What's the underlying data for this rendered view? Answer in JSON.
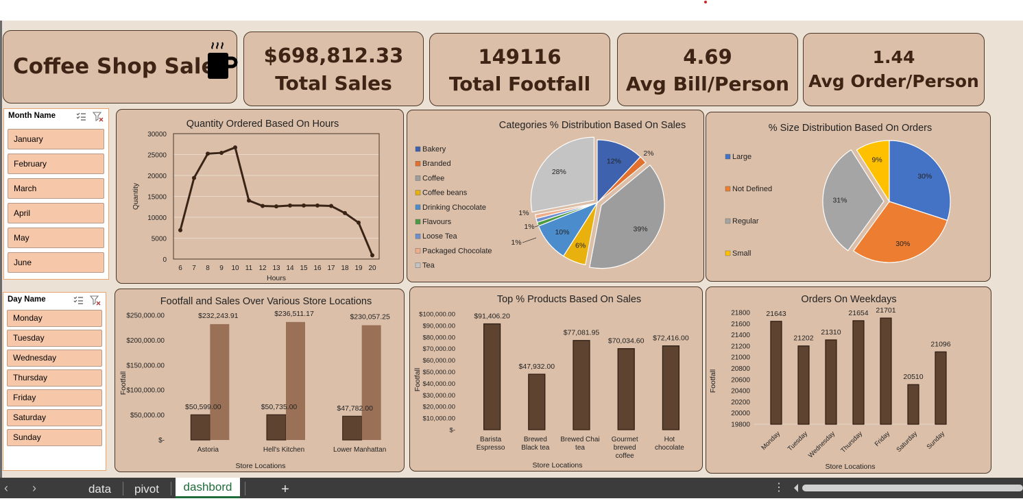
{
  "dashboard": {
    "title": "Coffee Shop Sales"
  },
  "kpis": [
    {
      "value": "$698,812.33",
      "label": "Total Sales"
    },
    {
      "value": "149116",
      "label": "Total Footfall"
    },
    {
      "value": "4.69",
      "label": "Avg Bill/Person"
    },
    {
      "value": "1.44",
      "label": "Avg Order/Person"
    }
  ],
  "slicers": {
    "month": {
      "title": "Month Name",
      "items": [
        "January",
        "February",
        "March",
        "April",
        "May",
        "June"
      ]
    },
    "day": {
      "title": "Day Name",
      "items": [
        "Monday",
        "Tuesday",
        "Wednesday",
        "Thursday",
        "Friday",
        "Saturday",
        "Sunday"
      ]
    }
  },
  "tabs": {
    "data": "data",
    "pivot": "pivot",
    "dashboard": "dashbord",
    "add": "+"
  },
  "colors": {
    "card": "#dbbfa9",
    "border": "#4a3526",
    "dark_bar": "#5e4330",
    "light_bar": "#9a7157",
    "line": "#3a2416"
  },
  "chart_data": [
    {
      "type": "line",
      "title": "Quantity Ordered Based On Hours",
      "xlabel": "Hours",
      "ylabel": "Quantity",
      "categories": [
        "6",
        "7",
        "8",
        "9",
        "10",
        "11",
        "12",
        "13",
        "14",
        "15",
        "16",
        "17",
        "18",
        "19",
        "20"
      ],
      "values": [
        6900,
        19400,
        25200,
        25400,
        26700,
        14000,
        12700,
        12600,
        12800,
        12800,
        12800,
        12700,
        11000,
        8700,
        900
      ],
      "ylim": [
        0,
        30000
      ],
      "yticks": [
        "0",
        "5000",
        "10000",
        "15000",
        "20000",
        "25000",
        "30000"
      ],
      "grid": true
    },
    {
      "type": "pie",
      "title": "Categories % Distribution Based On Sales",
      "legend": [
        "Bakery",
        "Branded",
        "Coffee",
        "Coffee beans",
        "Drinking Chocolate",
        "Flavours",
        "Loose Tea",
        "Packaged Chocolate",
        "Tea"
      ],
      "values": [
        12,
        2,
        39,
        6,
        10,
        1,
        1,
        1,
        28
      ],
      "labels": [
        "12%",
        "2%",
        "39%",
        "6%",
        "10%",
        "1%",
        "1%",
        "1%",
        "28%"
      ],
      "colors": [
        "#3e62ad",
        "#e2702e",
        "#9d9d9d",
        "#e8b10d",
        "#4b8dcc",
        "#4c9a43",
        "#6e8fcf",
        "#f0ad8a",
        "#c4c4c4"
      ],
      "legend_position": "left"
    },
    {
      "type": "pie",
      "title": "% Size Distribution Based On Orders",
      "legend": [
        "Large",
        "Not Defined",
        "Regular",
        "Small"
      ],
      "values": [
        30,
        30,
        31,
        9
      ],
      "labels": [
        "30%",
        "30%",
        "31%",
        "9%"
      ],
      "colors": [
        "#4472c4",
        "#ed7d31",
        "#a5a5a5",
        "#ffc000"
      ],
      "legend_position": "left"
    },
    {
      "type": "bar",
      "title": "Footfall  and Sales Over Various Store Locations",
      "xlabel": "Store Locations",
      "ylabel": "Footfall",
      "categories": [
        "Astoria",
        "Hell's Kitchen",
        "Lower Manhattan"
      ],
      "series": [
        {
          "values": [
            50599.0,
            50735.0,
            47782.0
          ],
          "labels": [
            "$50,599.00",
            "$50,735.00",
            "$47,782.00"
          ]
        },
        {
          "values": [
            232243.91,
            236511.17,
            230057.25
          ],
          "labels": [
            "$232,243.91",
            "$236,511.17",
            "$230,057.25"
          ]
        }
      ],
      "ylim": [
        0,
        250000
      ],
      "yticks": [
        "$-",
        "$50,000.00",
        "$100,000.00",
        "$150,000.00",
        "$200,000.00",
        "$250,000.00"
      ]
    },
    {
      "type": "bar",
      "title": "Top % Products Based On Sales",
      "xlabel": "Store Locations",
      "ylabel": "Footfall",
      "categories": [
        [
          "Barista",
          "Espresso"
        ],
        [
          "Brewed",
          "Black tea"
        ],
        [
          "Brewed Chai",
          "tea"
        ],
        [
          "Gourmet",
          "brewed",
          "coffee"
        ],
        [
          "Hot",
          "chocolate"
        ]
      ],
      "values": [
        91406.2,
        47932.0,
        77081.95,
        70034.6,
        72416.0
      ],
      "labels": [
        "$91,406.20",
        "$47,932.00",
        "$77,081.95",
        "$70,034.60",
        "$72,416.00"
      ],
      "ylim": [
        0,
        100000
      ],
      "yticks": [
        "$-",
        "$10,000.00",
        "$20,000.00",
        "$30,000.00",
        "$40,000.00",
        "$50,000.00",
        "$60,000.00",
        "$70,000.00",
        "$80,000.00",
        "$90,000.00",
        "$100,000.00"
      ]
    },
    {
      "type": "bar",
      "title": "Orders On Weekdays",
      "xlabel": "Store Locations",
      "ylabel": "Footfall",
      "categories": [
        "Monday",
        "Tuesday",
        "Wednesday",
        "Thursday",
        "Friday",
        "Saturday",
        "Sunday"
      ],
      "values": [
        21643,
        21202,
        21310,
        21654,
        21701,
        20510,
        21096
      ],
      "labels": [
        "21643",
        "21202",
        "21310",
        "21654",
        "21701",
        "20510",
        "21096"
      ],
      "ylim": [
        19800,
        21800
      ],
      "yticks": [
        "19800",
        "20000",
        "20200",
        "20400",
        "20600",
        "20800",
        "21000",
        "21200",
        "21400",
        "21600",
        "21800"
      ]
    }
  ]
}
